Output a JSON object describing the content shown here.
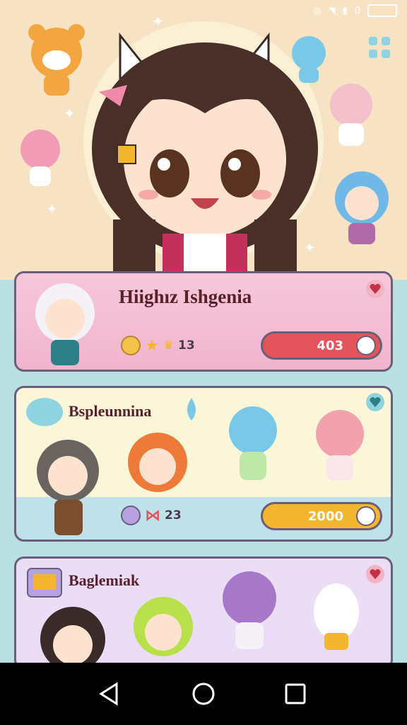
{
  "status": {
    "time": "",
    "battery": "0"
  },
  "cards": [
    {
      "title": "Hiighız Ishgenia",
      "value": "403",
      "stat": "13"
    },
    {
      "title": "Bspleunnina",
      "value": "2000",
      "stat": "23"
    },
    {
      "title": "Baglemiak"
    }
  ],
  "colors": {
    "bg_top": "#f7e3c3",
    "bg_bottom": "#b9e1e1",
    "card1": "#f6c7da",
    "card2": "#fbf6d8",
    "card3": "#eaddf5",
    "pill_red": "#e4545c",
    "pill_gold": "#f2b631"
  }
}
